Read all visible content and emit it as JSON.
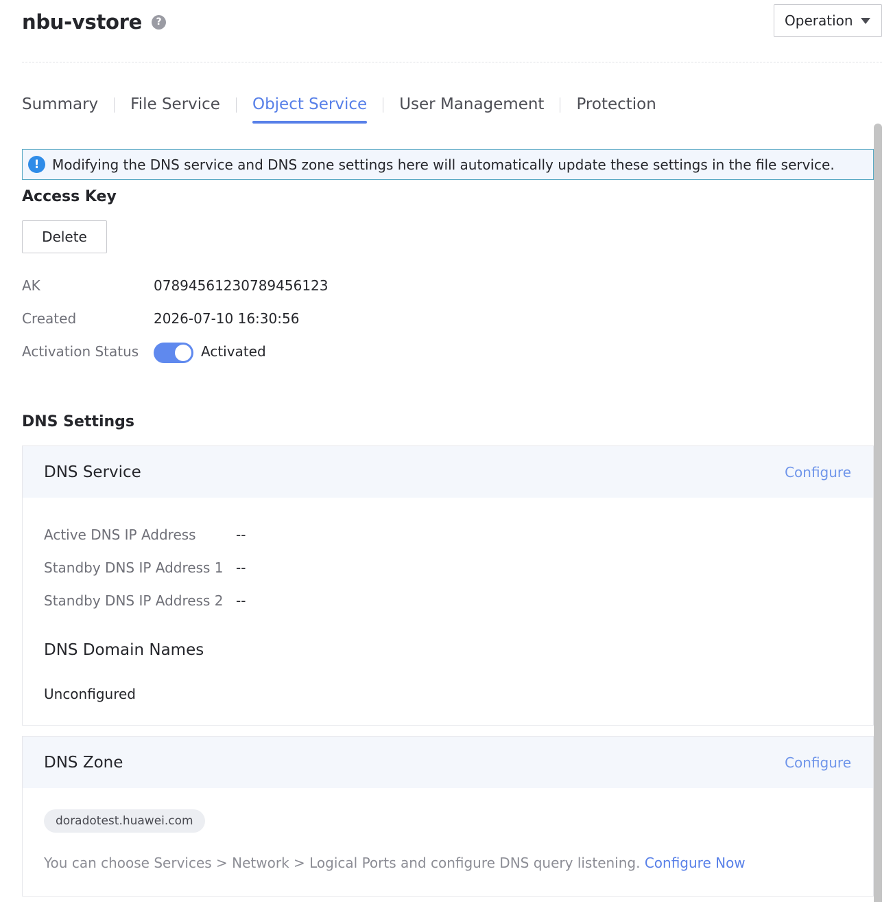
{
  "header": {
    "title": "nbu-vstore",
    "help_glyph": "?",
    "operation_label": "Operation"
  },
  "tabs": [
    {
      "label": "Summary",
      "active": false
    },
    {
      "label": "File Service",
      "active": false
    },
    {
      "label": "Object Service",
      "active": true
    },
    {
      "label": "User Management",
      "active": false
    },
    {
      "label": "Protection",
      "active": false
    }
  ],
  "notice": {
    "icon": "info-icon",
    "text": "Modifying the DNS service and DNS zone settings here will automatically update these settings in the file service."
  },
  "access_key": {
    "title": "Access Key",
    "delete_label": "Delete",
    "ak_label": "AK",
    "ak_value": "07894561230789456123",
    "created_label": "Created",
    "created_value": "2026-07-10 16:30:56",
    "status_label": "Activation Status",
    "status_value": "Activated",
    "status_on": true
  },
  "dns_settings": {
    "title": "DNS Settings",
    "dns_service": {
      "title": "DNS Service",
      "configure_label": "Configure",
      "active_label": "Active DNS IP Address",
      "active_value": "--",
      "standby1_label": "Standby DNS IP Address 1",
      "standby1_value": "--",
      "standby2_label": "Standby DNS IP Address 2",
      "standby2_value": "--",
      "domain_names_title": "DNS Domain Names",
      "domain_names_value": "Unconfigured"
    },
    "dns_zone": {
      "title": "DNS Zone",
      "configure_label": "Configure",
      "zone": "doradotest.huawei.com",
      "hint": "You can choose Services > Network > Logical Ports and configure DNS query listening.",
      "hint_link": "Configure Now"
    }
  },
  "colors": {
    "accent": "#5880e8",
    "notice_border": "#5aa9c4",
    "toggle_on": "#5f89ee"
  }
}
